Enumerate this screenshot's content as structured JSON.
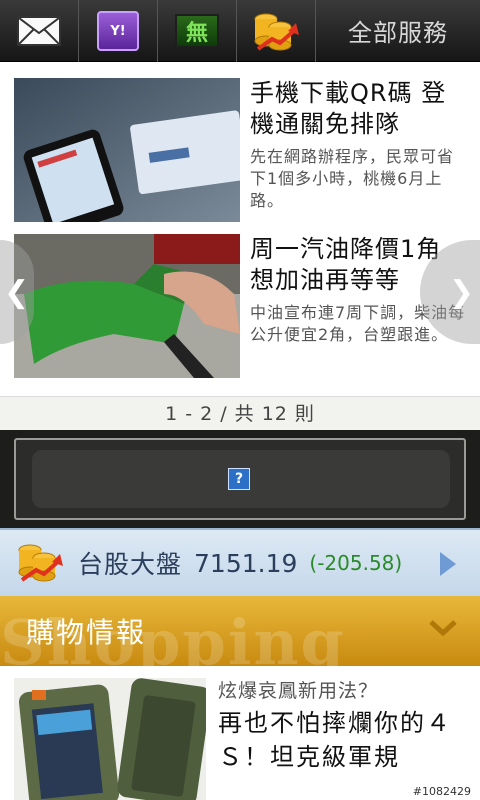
{
  "topbar": {
    "buttons": [
      {
        "icon": "mail-icon"
      },
      {
        "icon": "yahoo-shopping-bag-icon",
        "label": "Y!"
      },
      {
        "icon": "calculator-icon",
        "label": "無"
      },
      {
        "icon": "stock-coins-icon"
      }
    ],
    "services_label": "全部服務"
  },
  "news": {
    "items": [
      {
        "title": "手機下載QR碼 登機通關免排隊",
        "summary": "先在網路辦程序，民眾可省下1個多小時，桃機6月上路。"
      },
      {
        "title": "周一汽油降價1角 想加油再等等",
        "summary": "中油宣布連7周下調，柴油每公升便宜2角，台塑跟進。"
      }
    ],
    "pager": "1 - 2 / 共 12 則"
  },
  "ad": {
    "placeholder_icon": "?"
  },
  "stock": {
    "name": "台股大盤",
    "value": "7151.19",
    "change": "(-205.58)"
  },
  "shopping": {
    "header": "購物情報",
    "watermark": "Shopping",
    "item_subtitle": "炫爆哀鳳新用法？",
    "item_title": "再也不怕摔爛你的４Ｓ！坦克級軍規"
  },
  "image_watermark": "#1082429",
  "colors": {
    "topbar": "#1f1f1f",
    "shop_header": "#d9a024",
    "stock_change": "#2a8a2a"
  }
}
